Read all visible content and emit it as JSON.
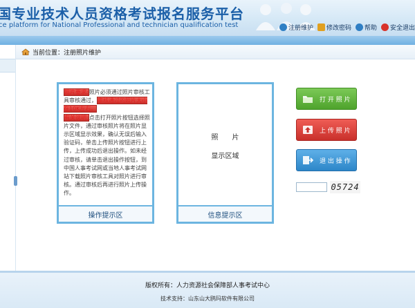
{
  "header": {
    "title": "国专业技术人员资格考试报名服务平台",
    "subtitle": "ce platform for National Professional and technician qualification test",
    "nav": [
      {
        "label": "注册维护",
        "icon": "globe-icon",
        "color": "#2f7fc4"
      },
      {
        "label": "修改密码",
        "icon": "lock-icon",
        "color": "#e0a020"
      },
      {
        "label": "帮助",
        "icon": "help-icon",
        "color": "#2f7fc4"
      },
      {
        "label": "安全退出",
        "icon": "power-icon",
        "color": "#d8332b"
      }
    ]
  },
  "breadcrumb": {
    "prefix": "当前位置：",
    "current": "注册照片维护"
  },
  "guide_panel": {
    "req_label": "照片要求:",
    "req_text": "照片必须通过照片审核工具审核通过，",
    "req_emphasis": "审核通过的照片大小在10K左右。",
    "info_label": "有关说明:",
    "info_text": "点击打开照片按钮选择照片文件，通过审核照片将在照片显示区域显示效果，确认无误后输入验证码，单击上传照片按钮进行上传，上传成功后退出操作。如未经过审核，请单击退出操作按钮，到中国人事考试网或当地人事考试网站下载照片审核工具对照片进行审核。通过审核后再进行照片上传操作。",
    "footer": "操作提示区"
  },
  "photo_panel": {
    "line1": "照　　片",
    "line2": "显示区域",
    "footer": "信息提示区"
  },
  "buttons": {
    "open": "打 开 照 片",
    "upload": "上 传 照 片",
    "exit": "退 出 操 作"
  },
  "captcha": {
    "value": "",
    "code": "05724"
  },
  "footer": {
    "copyright": "版权所有：人力资源社会保障部人事考试中心",
    "support": "技术支持：山东山大鸥玛软件有限公司"
  },
  "colors": {
    "panel_border": "#6cb5e0",
    "open_button": "#4ea32c",
    "upload_button": "#c9302b",
    "exit_button": "#2c86c8"
  }
}
